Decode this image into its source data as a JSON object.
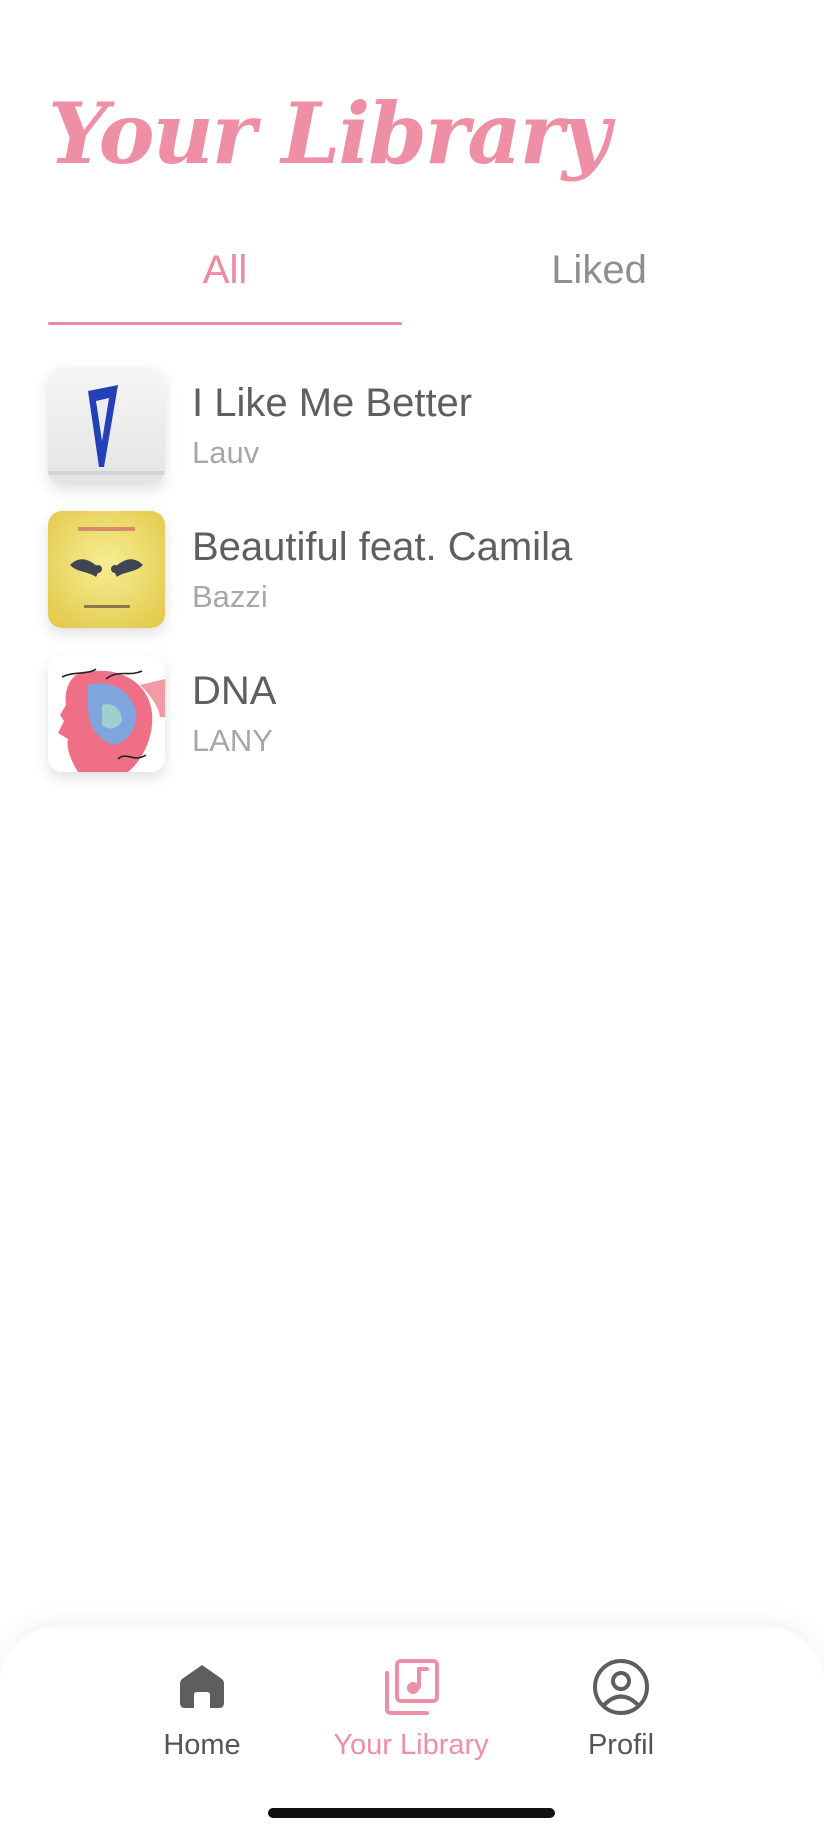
{
  "header": {
    "title": "Your Library"
  },
  "tabs": [
    {
      "label": "All",
      "active": true
    },
    {
      "label": "Liked",
      "active": false
    }
  ],
  "songs": [
    {
      "title": "I Like Me Better",
      "artist": "Lauv"
    },
    {
      "title": "Beautiful feat. Camila",
      "artist": "Bazzi"
    },
    {
      "title": "DNA",
      "artist": "LANY"
    }
  ],
  "bottom_nav": [
    {
      "label": "Home",
      "icon": "home-icon",
      "active": false
    },
    {
      "label": "Your Library",
      "icon": "music-library-icon",
      "active": true
    },
    {
      "label": "Profil",
      "icon": "profile-icon",
      "active": false
    }
  ],
  "colors": {
    "accent": "#ee8aa0",
    "text": "#5f5f5f",
    "muted": "#a7a7a7"
  }
}
